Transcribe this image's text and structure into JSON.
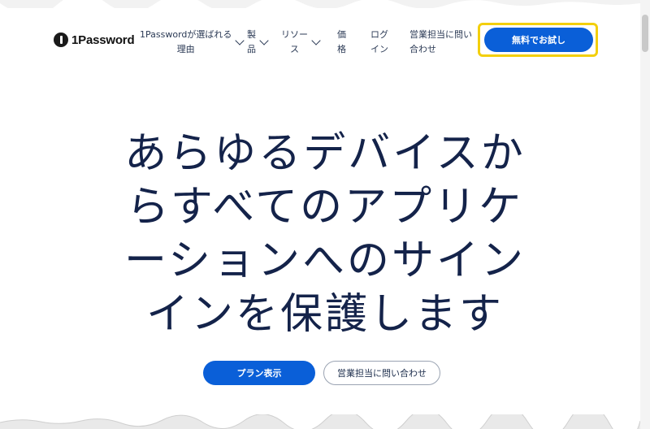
{
  "header": {
    "logo_text": "1Password",
    "nav": [
      {
        "line1": "1Passwordが選ばれる",
        "line2": "理由",
        "has_dropdown": true
      },
      {
        "line1": "製",
        "line2": "品",
        "has_dropdown": true
      },
      {
        "line1": "リソー",
        "line2": "ス",
        "has_dropdown": true
      },
      {
        "line1": "価",
        "line2": "格",
        "has_dropdown": false
      },
      {
        "line1": "ログ",
        "line2": "イン",
        "has_dropdown": false
      },
      {
        "line1": "営業担当に問い",
        "line2": "合わせ",
        "has_dropdown": false
      }
    ],
    "trial_label": "無料でお試し"
  },
  "hero": {
    "lines": [
      "あらゆるデバイスか",
      "らすべてのアプリケ",
      "ーションへのサイン",
      "インを保護します"
    ]
  },
  "cta": {
    "plans_label": "プラン表示",
    "sales_label": "営業担当に問い合わせ"
  },
  "colors": {
    "primary": "#0a5fd8",
    "highlight": "#f3cf0c",
    "text": "#14234a"
  }
}
